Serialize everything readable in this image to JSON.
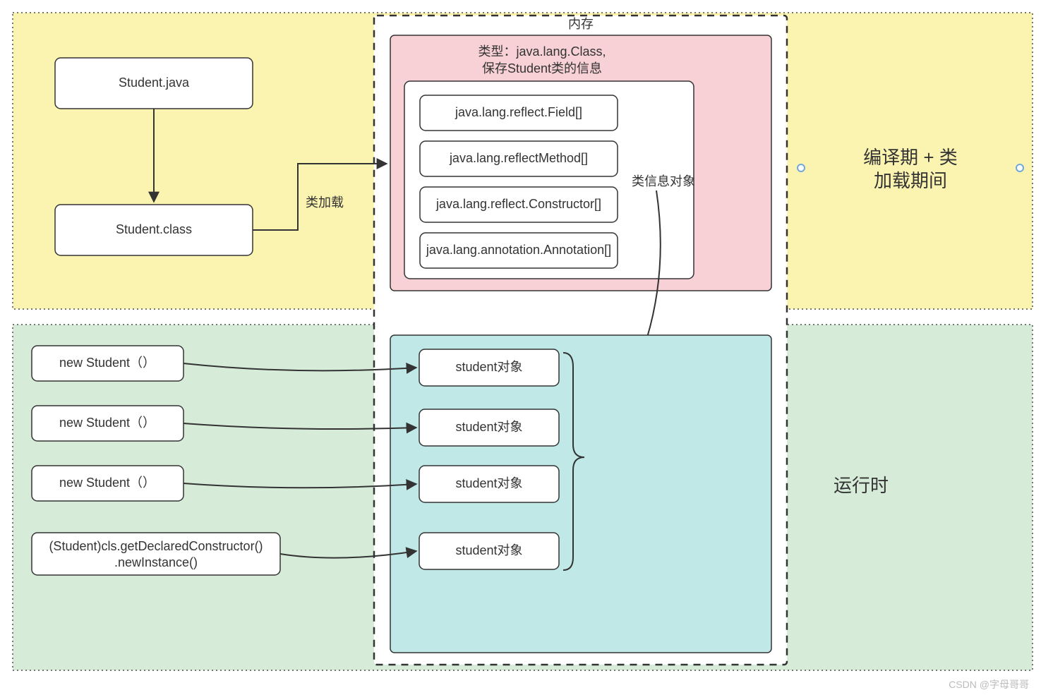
{
  "regions": {
    "memory_title": "内存",
    "compile_label_line1": "编译期 + 类",
    "compile_label_line2": "加载期间",
    "runtime_label": "运行时"
  },
  "left_top": {
    "source_file": "Student.java",
    "class_file": "Student.class",
    "load_label": "类加载"
  },
  "class_info": {
    "title_line1": "类型：java.lang.Class,",
    "title_line2": "保存Student类的信息",
    "items": [
      "java.lang.reflect.Field[]",
      "java.lang.reflectMethod[]",
      "java.lang.reflect.Constructor[]",
      "java.lang.annotation.Annotation[]"
    ],
    "side_label": "类信息对象"
  },
  "runtime_calls": [
    "new Student（）",
    "new Student（）",
    "new Student（）",
    "(Student)cls.getDeclaredConstructor()\n.newInstance()"
  ],
  "runtime_objects": [
    "student对象",
    "student对象",
    "student对象",
    "student对象"
  ],
  "watermark": "CSDN @字母哥哥",
  "colors": {
    "yellow": "#fbf3b0",
    "pink": "#f7d1d5",
    "cyan": "#c0e8e6",
    "green": "#d6ecd9"
  }
}
